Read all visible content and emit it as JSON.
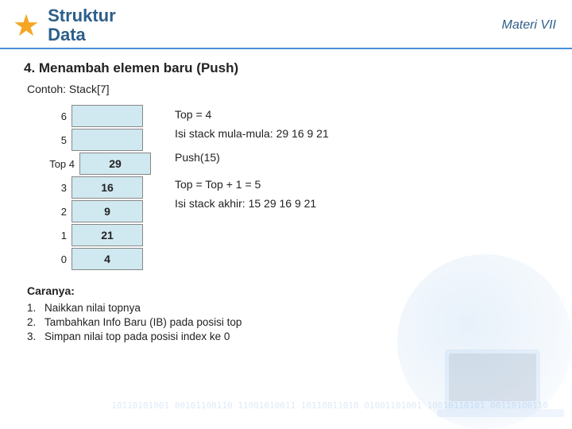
{
  "header": {
    "title_line1": "Struktur",
    "title_line2": "Data",
    "materi": "Materi VII"
  },
  "section": {
    "title": "4.  Menambah elemen baru (Push)",
    "contoh": "Contoh:  Stack[7]"
  },
  "stack": {
    "rows": [
      {
        "index": "6",
        "value": "",
        "empty": true
      },
      {
        "index": "5",
        "value": "",
        "empty": true
      },
      {
        "index": "4",
        "value": "29",
        "empty": false,
        "is_top": true
      },
      {
        "index": "3",
        "value": "16",
        "empty": false
      },
      {
        "index": "2",
        "value": "9",
        "empty": false
      },
      {
        "index": "1",
        "value": "21",
        "empty": false
      },
      {
        "index": "0",
        "value": "4",
        "empty": false
      }
    ],
    "top_label": "Top"
  },
  "info": {
    "top_eq": "Top = 4",
    "isi_stack_mula": "Isi stack mula-mula:  29 16  9  21",
    "push": "Push(15)",
    "top_calc": "Top = Top + 1 = 5",
    "isi_stack_akhir": "Isi stack akhir:  15  29 16  9  21"
  },
  "caranya": {
    "title": "Caranya:",
    "steps": [
      {
        "num": "1.",
        "text": "Naikkan nilai topnya"
      },
      {
        "num": "2.",
        "text": "Tambahkan Info Baru (IB) pada posisi top"
      },
      {
        "num": "3.",
        "text": "Simpan nilai top pada posisi index ke 0"
      }
    ]
  },
  "bg_binary": "10110101001\n00101100110\n11001010011\n10110011010\n01001101001\n10010110101\n00110100110"
}
